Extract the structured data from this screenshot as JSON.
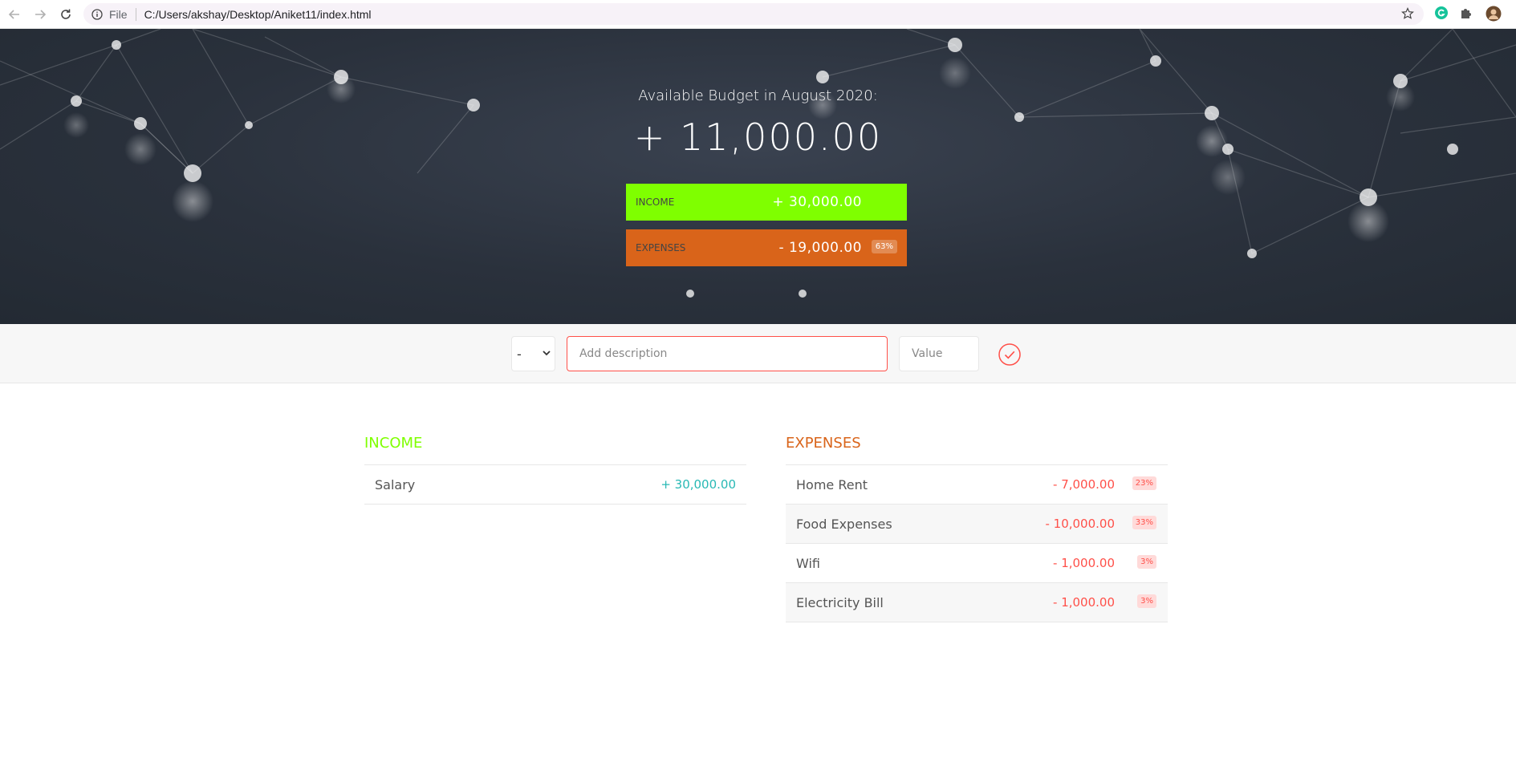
{
  "browser": {
    "scheme_label": "File",
    "url": "C:/Users/akshay/Desktop/Aniket11/index.html"
  },
  "budget": {
    "title": "Available Budget in August 2020:",
    "value": "+ 11,000.00",
    "income_label": "Income",
    "income_value": "+ 30,000.00",
    "expenses_label": "Expenses",
    "expenses_value": "- 19,000.00",
    "expenses_percentage": "63%"
  },
  "add_form": {
    "type_selected": "-",
    "description_placeholder": "Add description",
    "value_placeholder": "Value"
  },
  "income": {
    "title": "Income",
    "items": [
      {
        "description": "Salary",
        "value": "+ 30,000.00"
      }
    ]
  },
  "expenses": {
    "title": "Expenses",
    "items": [
      {
        "description": "Home Rent",
        "value": "- 7,000.00",
        "percentage": "23%"
      },
      {
        "description": "Food Expenses",
        "value": "- 10,000.00",
        "percentage": "33%"
      },
      {
        "description": "Wifi",
        "value": "- 1,000.00",
        "percentage": "3%"
      },
      {
        "description": "Electricity Bill",
        "value": "- 1,000.00",
        "percentage": "3%"
      }
    ]
  },
  "colors": {
    "income": "#7fff00",
    "expenses": "#d9641a",
    "income_value": "#28b9b5",
    "expense_value": "#ff5049"
  }
}
